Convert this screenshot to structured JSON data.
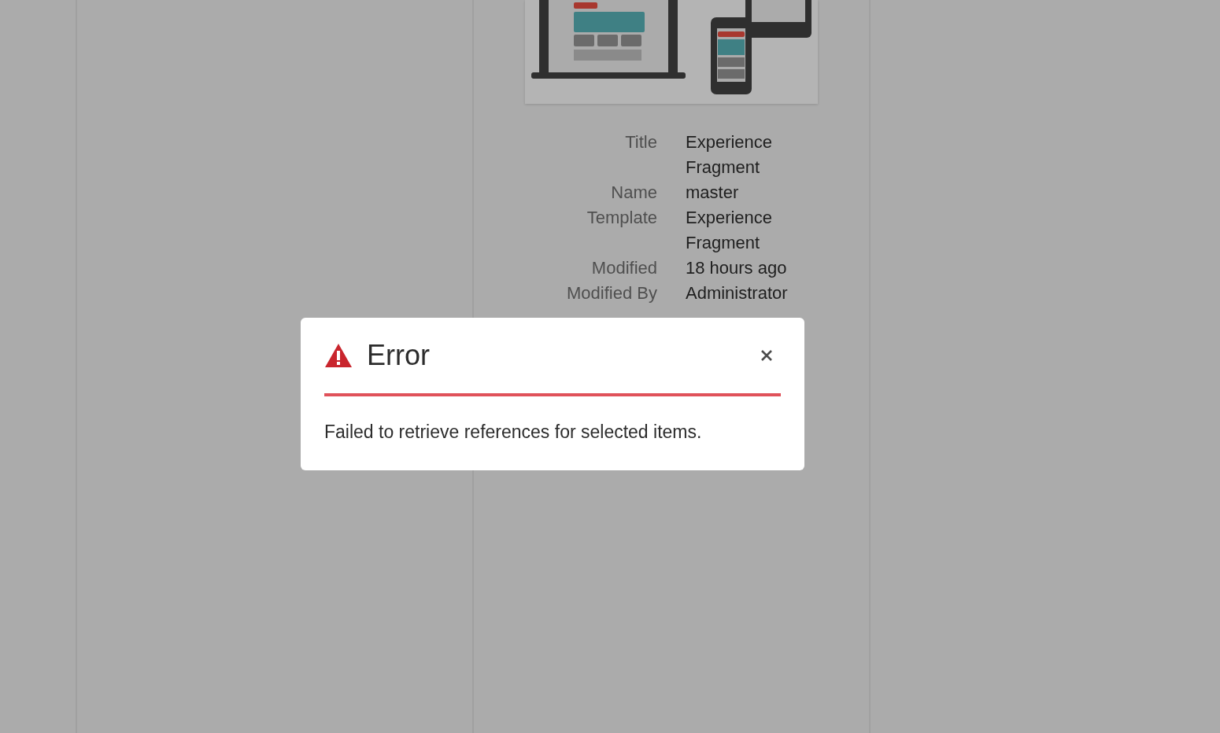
{
  "properties": [
    {
      "label": "Title",
      "value": "Experience Fragment"
    },
    {
      "label": "Name",
      "value": "master"
    },
    {
      "label": "Template",
      "value": "Experience Fragment"
    },
    {
      "label": "Modified",
      "value": "18 hours ago"
    },
    {
      "label": "Modified By",
      "value": "Administrator"
    }
  ],
  "dialog": {
    "kind": "error",
    "title": "Error",
    "message": "Failed to retrieve references for selected items."
  }
}
